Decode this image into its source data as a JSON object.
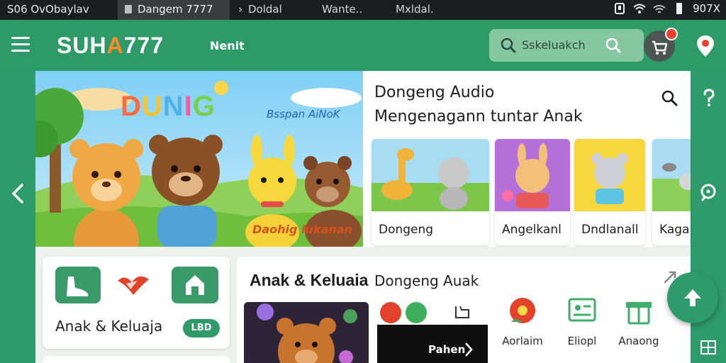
{
  "status_bar": {
    "left_text": "S06 OvObaylav",
    "tabs": [
      {
        "label": "Dangem 7777",
        "active": true
      },
      {
        "label": "Doldal",
        "active": false
      },
      {
        "label": "Wante..",
        "active": false
      },
      {
        "label": "Mxldal.",
        "active": false
      }
    ],
    "clock": "907X"
  },
  "app_bar": {
    "logo_main": "SUH",
    "logo_accent": "A",
    "logo_tail": "777",
    "nav_link": "Nenit",
    "search_placeholder": "Sskeluakch",
    "accent_color": "#2e9a68",
    "badge_color": "#e8412f"
  },
  "hero": {
    "title_letters": [
      "D",
      "U",
      "N",
      "I",
      "G"
    ],
    "tagline": "Bsspan AiNoK",
    "caption": "Daohig lukanan"
  },
  "panel": {
    "heading_line1": "Dongeng Audio",
    "heading_line2": "Mengenagann tuntar Anak",
    "cards": [
      {
        "label": "Dongeng"
      },
      {
        "label": "Angelkanl"
      },
      {
        "label": "Dndlanall"
      },
      {
        "label": "Kaga"
      }
    ]
  },
  "category_card": {
    "label": "Anak & Keluaja",
    "pill": "LBD"
  },
  "section": {
    "title": "Anak & Keluaia",
    "subtitle": "Dongeng Auak",
    "dark_label": "Pahen",
    "features": [
      {
        "label": "Aorlaim",
        "icon": "flower-icon"
      },
      {
        "label": "Eliopl",
        "icon": "id-card-icon"
      },
      {
        "label": "Anaong",
        "icon": "gift-icon"
      }
    ]
  }
}
